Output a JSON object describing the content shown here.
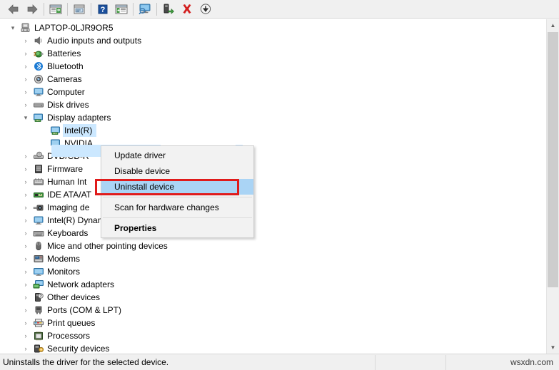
{
  "toolbar": {
    "buttons": [
      {
        "name": "back-button",
        "icon": "left-arrow-icon",
        "label": "Back"
      },
      {
        "name": "forward-button",
        "icon": "right-arrow-icon",
        "label": "Forward"
      },
      {
        "name": "separator-1",
        "icon": "separator",
        "label": ""
      },
      {
        "name": "show-hide-console-tree-button",
        "icon": "console-tree-icon",
        "label": "Show/Hide Console Tree"
      },
      {
        "name": "separator-2",
        "icon": "separator",
        "label": ""
      },
      {
        "name": "properties-button",
        "icon": "properties-window-icon",
        "label": "Properties"
      },
      {
        "name": "separator-3",
        "icon": "separator",
        "label": ""
      },
      {
        "name": "help-button",
        "icon": "help-question-icon",
        "label": "Help"
      },
      {
        "name": "show-action-pane-button",
        "icon": "action-pane-icon",
        "label": "Show Action Pane"
      },
      {
        "name": "separator-4",
        "icon": "separator",
        "label": ""
      },
      {
        "name": "scan-hardware-changes-button",
        "icon": "monitor-scan-icon",
        "label": "Scan for hardware changes"
      },
      {
        "name": "separator-5",
        "icon": "separator",
        "label": ""
      },
      {
        "name": "update-driver-button",
        "icon": "update-driver-icon",
        "label": "Update driver"
      },
      {
        "name": "uninstall-device-button",
        "icon": "red-x-icon",
        "label": "Uninstall device"
      },
      {
        "name": "disable-device-button",
        "icon": "down-arrow-circle-icon",
        "label": "Disable device"
      }
    ]
  },
  "tree": {
    "root": {
      "label": "LAPTOP-0LJR9OR5",
      "icon": "computer-node-icon",
      "expanded": true
    },
    "items": [
      {
        "label": "Audio inputs and outputs",
        "icon": "speaker-icon",
        "expanded": false,
        "level": 1
      },
      {
        "label": "Batteries",
        "icon": "battery-icon",
        "expanded": false,
        "level": 1
      },
      {
        "label": "Bluetooth",
        "icon": "bluetooth-icon",
        "expanded": false,
        "level": 1
      },
      {
        "label": "Cameras",
        "icon": "camera-icon",
        "expanded": false,
        "level": 1
      },
      {
        "label": "Computer",
        "icon": "computer-icon",
        "expanded": false,
        "level": 1
      },
      {
        "label": "Disk drives",
        "icon": "disk-drive-icon",
        "expanded": false,
        "level": 1
      },
      {
        "label": "Display adapters",
        "icon": "display-adapter-icon",
        "expanded": true,
        "level": 1
      },
      {
        "label": "Intel(R)",
        "icon": "display-adapter-icon",
        "expanded": null,
        "level": 2,
        "selected": true
      },
      {
        "label": "NVIDIA",
        "icon": "display-adapter-icon",
        "expanded": null,
        "level": 2
      },
      {
        "label": "DVD/CD-R",
        "icon": "dvd-drive-icon",
        "expanded": false,
        "level": 1
      },
      {
        "label": "Firmware",
        "icon": "firmware-icon",
        "expanded": false,
        "level": 1
      },
      {
        "label": "Human Int",
        "icon": "hid-icon",
        "expanded": false,
        "level": 1
      },
      {
        "label": "IDE ATA/AT",
        "icon": "ide-controller-icon",
        "expanded": false,
        "level": 1
      },
      {
        "label": "Imaging de",
        "icon": "imaging-device-icon",
        "expanded": false,
        "level": 1
      },
      {
        "label": "Intel(R) Dynamic Platform and Thermal Framework",
        "icon": "thermal-framework-icon",
        "expanded": false,
        "level": 1
      },
      {
        "label": "Keyboards",
        "icon": "keyboard-icon",
        "expanded": false,
        "level": 1
      },
      {
        "label": "Mice and other pointing devices",
        "icon": "mouse-icon",
        "expanded": false,
        "level": 1
      },
      {
        "label": "Modems",
        "icon": "modem-icon",
        "expanded": false,
        "level": 1
      },
      {
        "label": "Monitors",
        "icon": "monitor-icon",
        "expanded": false,
        "level": 1
      },
      {
        "label": "Network adapters",
        "icon": "network-adapter-icon",
        "expanded": false,
        "level": 1
      },
      {
        "label": "Other devices",
        "icon": "other-device-icon",
        "expanded": false,
        "level": 1
      },
      {
        "label": "Ports (COM & LPT)",
        "icon": "port-icon",
        "expanded": false,
        "level": 1
      },
      {
        "label": "Print queues",
        "icon": "printer-icon",
        "expanded": false,
        "level": 1
      },
      {
        "label": "Processors",
        "icon": "processor-icon",
        "expanded": false,
        "level": 1
      },
      {
        "label": "Security devices",
        "icon": "security-device-icon",
        "expanded": false,
        "level": 1
      }
    ]
  },
  "context_menu": {
    "items": [
      {
        "label": "Update driver",
        "highlighted": false,
        "bold": false
      },
      {
        "label": "Disable device",
        "highlighted": false,
        "bold": false
      },
      {
        "label": "Uninstall device",
        "highlighted": true,
        "bold": false
      },
      {
        "label": "Scan for hardware changes",
        "highlighted": false,
        "bold": false
      },
      {
        "label": "Properties",
        "highlighted": false,
        "bold": true
      }
    ]
  },
  "annotation": {
    "target": "Uninstall device",
    "color": "#e01b1b"
  },
  "status_bar": {
    "text": "Uninstalls the driver for the selected device.",
    "watermark": "wsxdn.com"
  },
  "colors": {
    "selection": "#cce8ff",
    "menu_highlight": "#aad4f5",
    "annotation_red": "#e01b1b",
    "chrome": "#f0f0f0"
  }
}
